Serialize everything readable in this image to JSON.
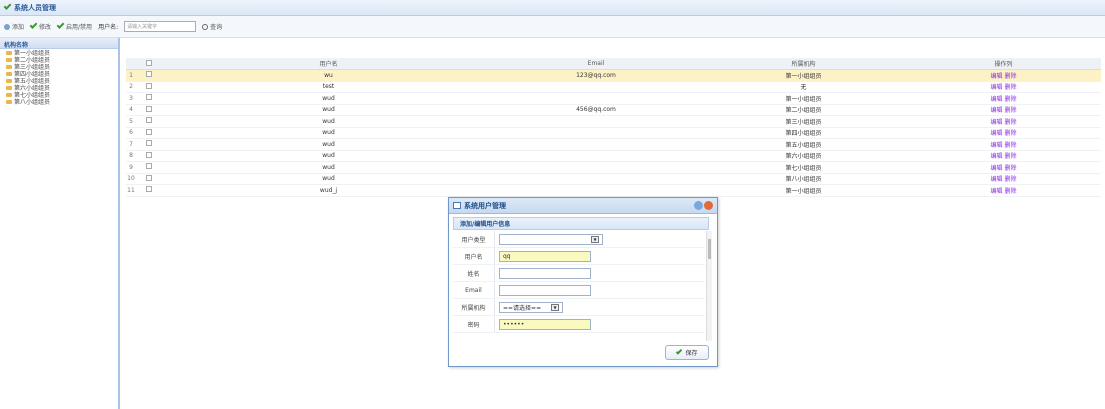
{
  "window": {
    "title": "系统人员管理"
  },
  "toolbar": {
    "add_label": "添加",
    "edit_label": "修改",
    "enable_label": "启用/禁用",
    "username_label": "用户名:",
    "username_placeholder": "请输入关键字",
    "search_label": "查询"
  },
  "sidebar": {
    "header": "机构名称",
    "items": [
      "第一小组组员",
      "第二小组组员",
      "第三小组组员",
      "第四小组组员",
      "第五小组组员",
      "第六小组组员",
      "第七小组组员",
      "第八小组组员"
    ]
  },
  "grid": {
    "headers": {
      "user": "用户名",
      "email": "Email",
      "org": "所属机构",
      "ops": "操作列"
    },
    "rows": [
      {
        "idx": "1",
        "user": "wu",
        "email": "123@qq.com",
        "org": "第一小组组员",
        "ops": "编辑 删除"
      },
      {
        "idx": "2",
        "user": "test",
        "email": "",
        "org": "无",
        "ops": "编辑 删除"
      },
      {
        "idx": "3",
        "user": "wud",
        "email": "",
        "org": "第一小组组员",
        "ops": "编辑 删除"
      },
      {
        "idx": "4",
        "user": "wud",
        "email": "456@qq.com",
        "org": "第二小组组员",
        "ops": "编辑 删除"
      },
      {
        "idx": "5",
        "user": "wud",
        "email": "",
        "org": "第三小组组员",
        "ops": "编辑 删除"
      },
      {
        "idx": "6",
        "user": "wud",
        "email": "",
        "org": "第四小组组员",
        "ops": "编辑 删除"
      },
      {
        "idx": "7",
        "user": "wud",
        "email": "",
        "org": "第五小组组员",
        "ops": "编辑 删除"
      },
      {
        "idx": "8",
        "user": "wud",
        "email": "",
        "org": "第六小组组员",
        "ops": "编辑 删除"
      },
      {
        "idx": "9",
        "user": "wud",
        "email": "",
        "org": "第七小组组员",
        "ops": "编辑 删除"
      },
      {
        "idx": "10",
        "user": "wud",
        "email": "",
        "org": "第八小组组员",
        "ops": "编辑 删除"
      },
      {
        "idx": "11",
        "user": "wud_j",
        "email": "",
        "org": "第一小组组员",
        "ops": "编辑 删除"
      }
    ]
  },
  "dialog": {
    "title": "系统用户管理",
    "subtitle": "添加/编辑用户信息",
    "fields": {
      "type_label": "用户类型",
      "type_value": "",
      "name_label": "用户名",
      "name_value": "qq",
      "realname_label": "姓名",
      "realname_value": "",
      "email_label": "Email",
      "email_value": "",
      "org_label": "所属机构",
      "org_value": "==请选择==",
      "password_label": "密码",
      "password_value": "••••••"
    },
    "save_label": "保存"
  }
}
